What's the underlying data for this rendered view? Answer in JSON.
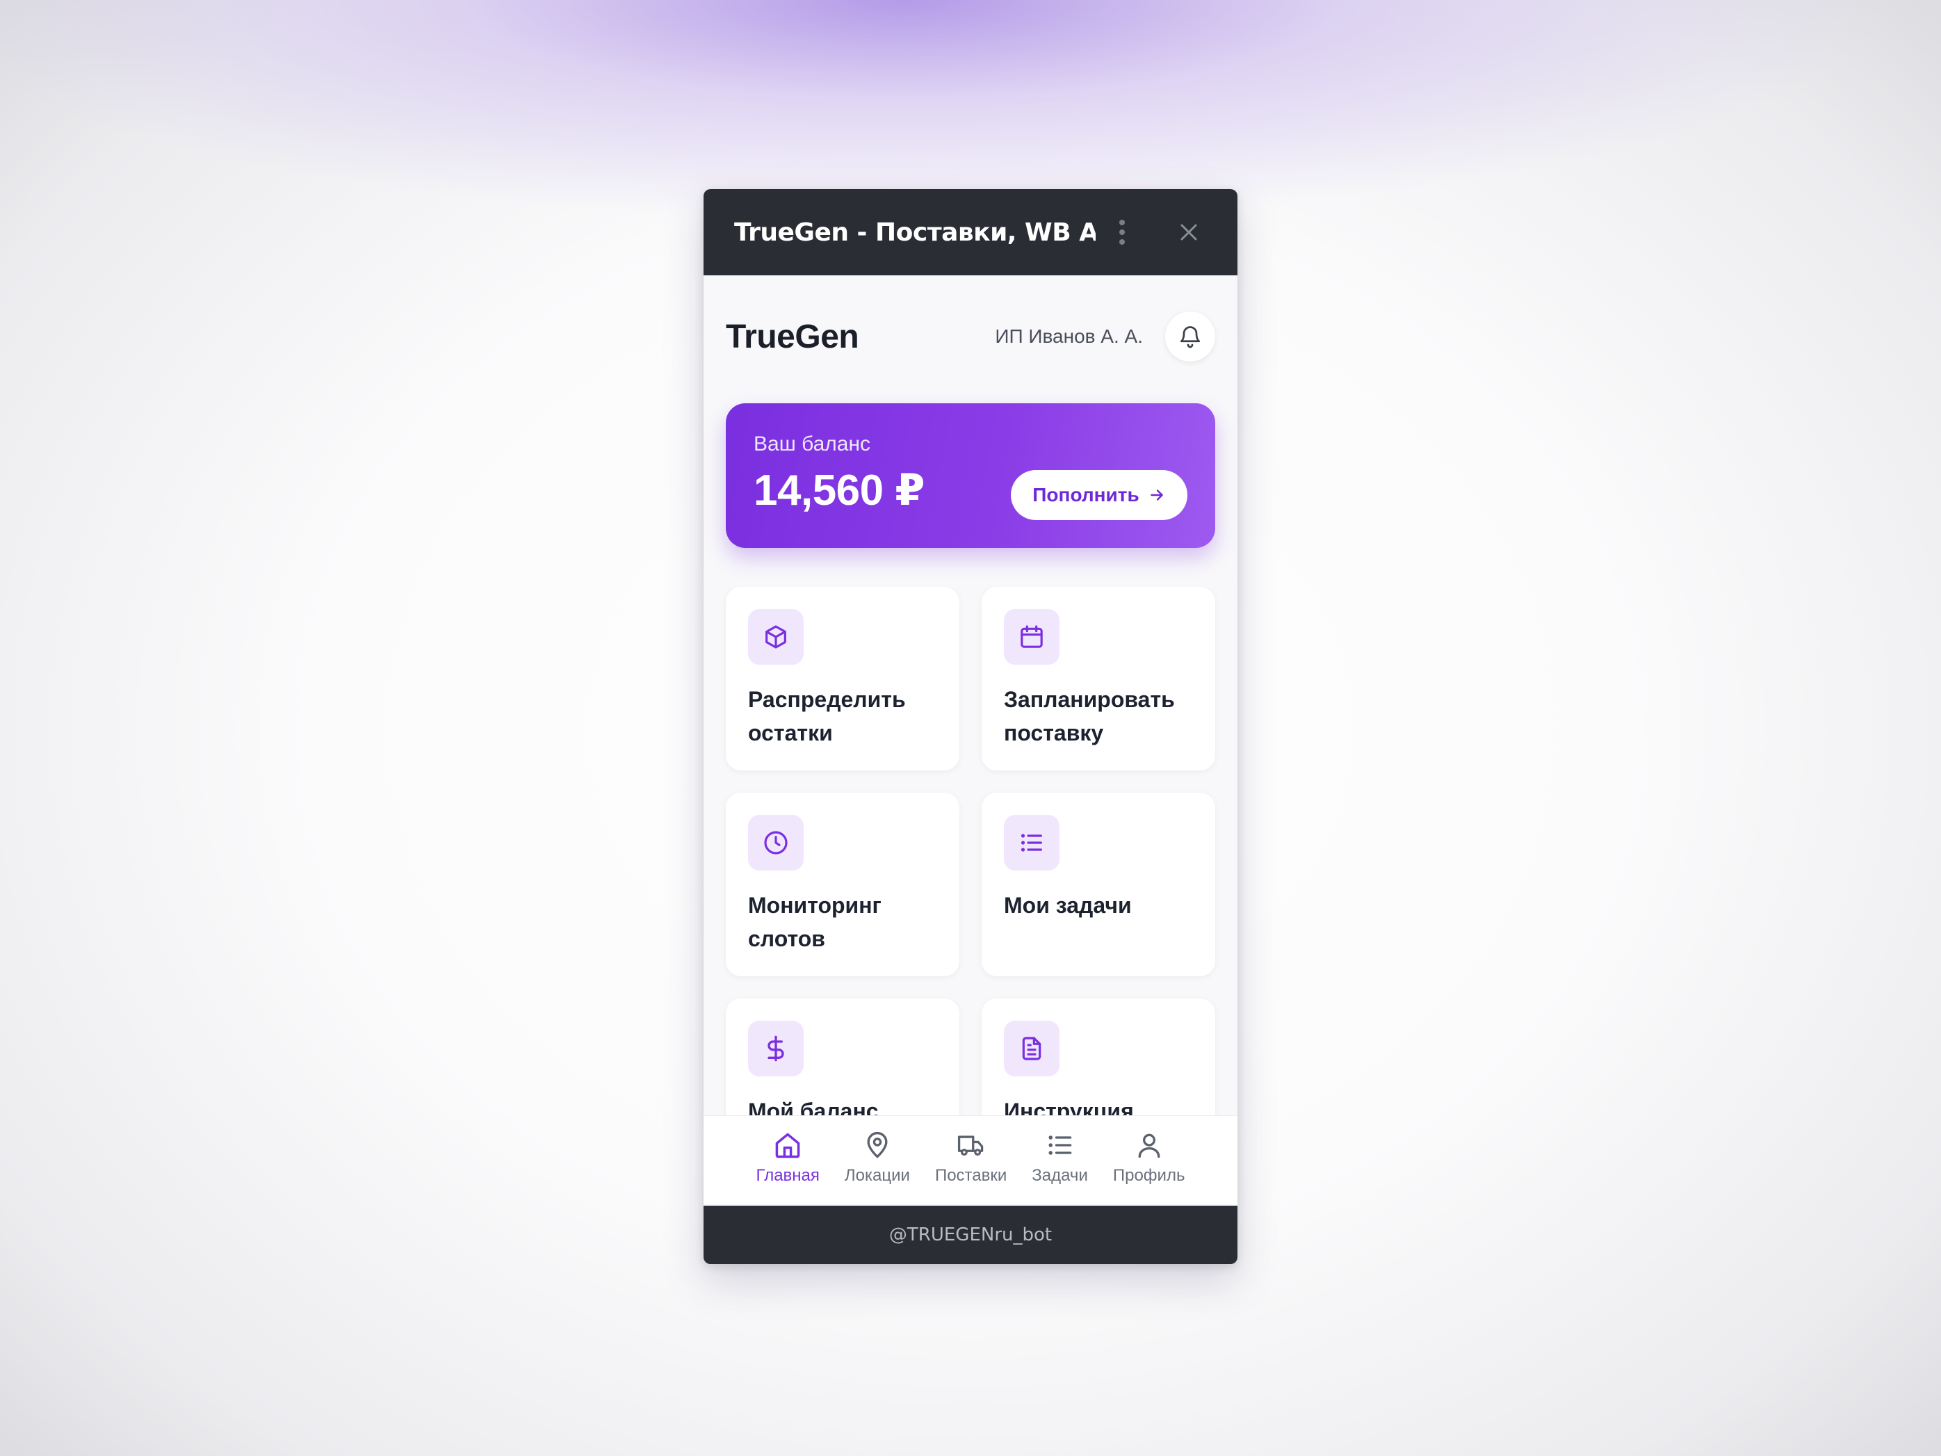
{
  "window": {
    "title": "TrueGen - Поставки, WB Ав...",
    "footer": "@TRUEGENru_bot"
  },
  "header": {
    "brand": "TrueGen",
    "user": "ИП Иванов А. А.",
    "bell_icon": "bell-icon"
  },
  "balance": {
    "label": "Ваш баланс",
    "amount": "14,560 ₽",
    "topup_label": "Пополнить"
  },
  "tiles": [
    {
      "label": "Распределить остатки",
      "icon": "box-icon"
    },
    {
      "label": "Запланировать поставку",
      "icon": "calendar-icon"
    },
    {
      "label": "Мониторинг слотов",
      "icon": "clock-icon"
    },
    {
      "label": "Мои задачи",
      "icon": "list-icon"
    },
    {
      "label": "Мой баланс",
      "icon": "dollar-icon"
    },
    {
      "label": "Инструкция",
      "icon": "document-icon"
    }
  ],
  "nav": [
    {
      "label": "Главная",
      "icon": "home-icon",
      "active": true
    },
    {
      "label": "Локации",
      "icon": "map-pin-icon"
    },
    {
      "label": "Поставки",
      "icon": "truck-icon"
    },
    {
      "label": "Задачи",
      "icon": "list-icon"
    },
    {
      "label": "Профиль",
      "icon": "user-icon"
    }
  ],
  "colors": {
    "accent": "#7a2fe0",
    "tile_icon_bg": "#f1e7fd",
    "titlebar": "#2a2d33"
  }
}
